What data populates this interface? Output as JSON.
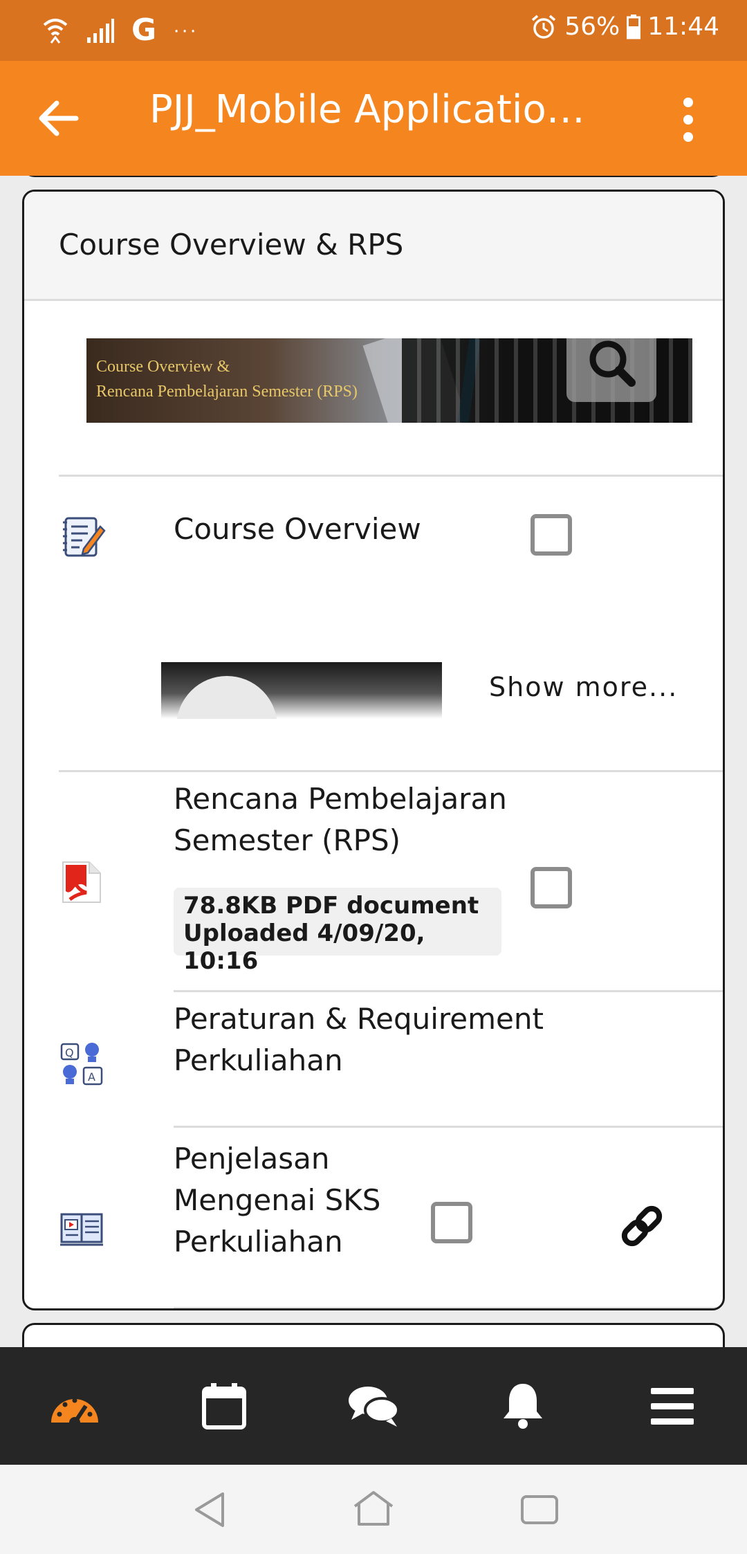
{
  "status_bar": {
    "carrier_icon": "G",
    "more_indicator": "···",
    "battery": "56%",
    "time": "11:44"
  },
  "toolbar": {
    "title": "PJJ_Mobile Application…"
  },
  "section": {
    "title": "Course Overview & RPS",
    "banner_line1": "Course Overview &",
    "banner_line2": "Rencana Pembelajaran Semester (RPS)"
  },
  "items": [
    {
      "label": "Course Overview",
      "icon": "assignment-icon",
      "checked": false
    },
    {
      "label_line1": "Rencana Pembelajaran",
      "label_line2": "Semester (RPS)",
      "icon": "pdf-icon",
      "checked": false,
      "meta_line1": "78.8KB PDF document",
      "meta_line2": "Uploaded 4/09/20, 10:16"
    },
    {
      "label_line1": "Peraturan & Requirement",
      "label_line2": "Perkuliahan",
      "icon": "qa-icon"
    },
    {
      "label_line1": "Penjelasan",
      "label_line2": "Mengenai SKS",
      "label_line3": "Perkuliahan",
      "icon": "video-book-icon",
      "checked": false
    }
  ],
  "show_more": "Show more...",
  "bottom_nav": [
    "dashboard-icon",
    "calendar-icon",
    "messages-icon",
    "notifications-icon",
    "menu-icon"
  ],
  "colors": {
    "status_bar": "#d9731f",
    "toolbar": "#f4851f",
    "accent": "#f4851f",
    "bottom_nav": "#262626"
  }
}
